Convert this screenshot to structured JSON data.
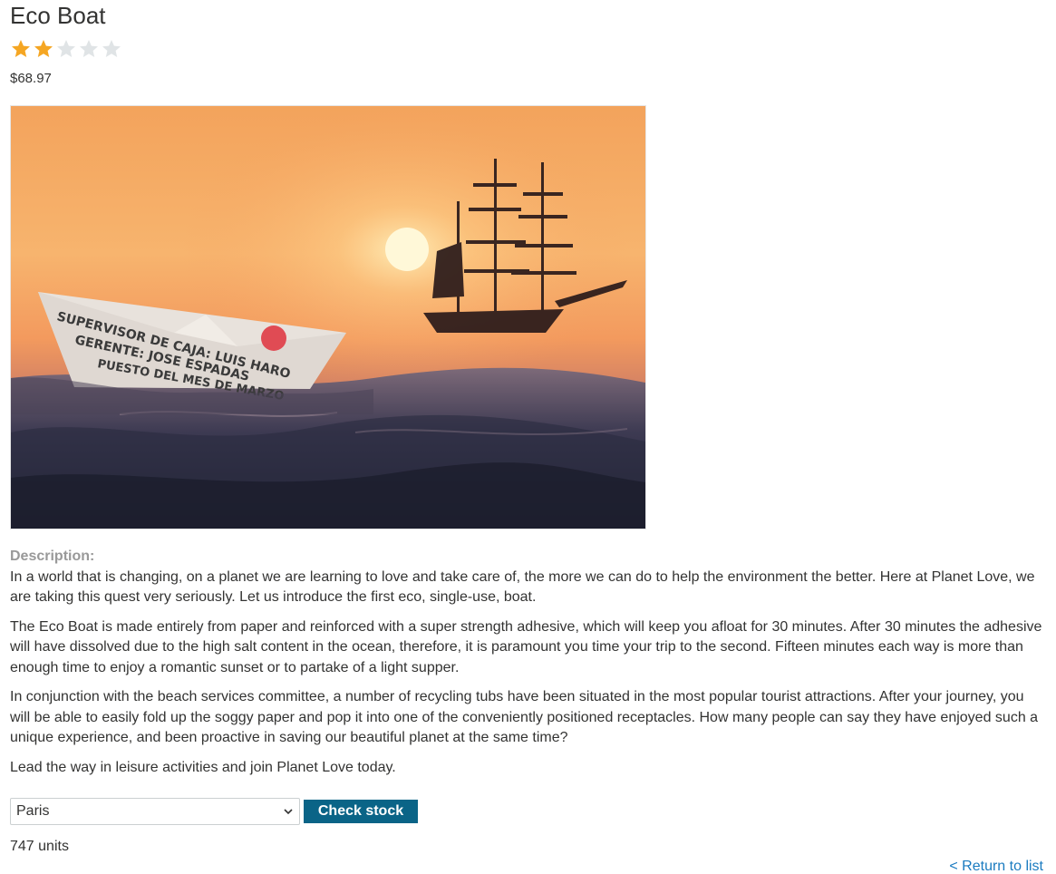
{
  "product": {
    "title": "Eco Boat",
    "rating": {
      "value": 2,
      "max": 5
    },
    "price": "$68.97",
    "image_alt": "Paper boat on the ocean at sunset with a sailing ship",
    "image_text": [
      "SUPERVISOR DE CAJA: LUIS HARO",
      "GERENTE: JOSE ESPADAS",
      "PUESTO DEL MES DE MARZO"
    ]
  },
  "description": {
    "label": "Description:",
    "paragraphs": [
      "In a world that is changing, on a planet we are learning to love and take care of, the more we can do to help the environment the better. Here at Planet Love, we are taking this quest very seriously. Let us introduce the first eco, single-use, boat.",
      "The Eco Boat is made entirely from paper and reinforced with a super strength adhesive, which will keep you afloat for 30 minutes. After 30 minutes the adhesive will have dissolved due to the high salt content in the ocean, therefore, it is paramount you time your trip to the second. Fifteen minutes each way is more than enough time to enjoy a romantic sunset or to partake of a light supper.",
      "In conjunction with the beach services committee, a number of recycling tubs have been situated in the most popular tourist attractions. After your journey, you will be able to easily fold up the soggy paper and pop it into one of the conveniently positioned receptacles. How many people can say they have enjoyed such a unique experience, and been proactive in saving our beautiful planet at the same time?",
      "Lead the way in leisure activities and join Planet Love today."
    ]
  },
  "stock": {
    "selected_store": "Paris",
    "button_label": "Check stock",
    "result": "747 units"
  },
  "nav": {
    "return_link": "< Return to list"
  },
  "colors": {
    "star_filled": "#f5a623",
    "star_empty": "#e0e4e6",
    "button_bg": "#0a6487",
    "link": "#1a7bc0",
    "label_grey": "#999999"
  },
  "icons": {
    "star": "star-icon",
    "select_chevron": "chevron-down-icon"
  }
}
